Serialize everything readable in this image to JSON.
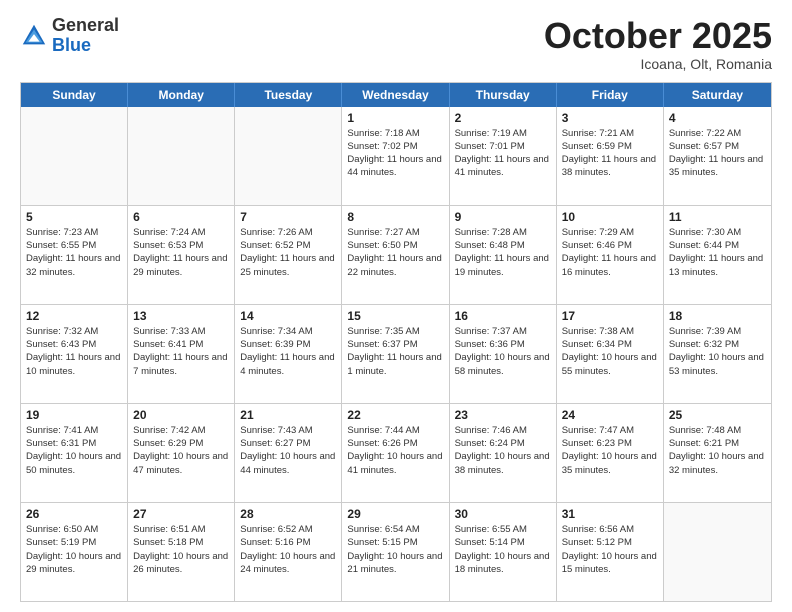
{
  "header": {
    "logo_general": "General",
    "logo_blue": "Blue",
    "month_title": "October 2025",
    "subtitle": "Icoana, Olt, Romania"
  },
  "weekdays": [
    "Sunday",
    "Monday",
    "Tuesday",
    "Wednesday",
    "Thursday",
    "Friday",
    "Saturday"
  ],
  "weeks": [
    [
      {
        "day": "",
        "info": ""
      },
      {
        "day": "",
        "info": ""
      },
      {
        "day": "",
        "info": ""
      },
      {
        "day": "1",
        "info": "Sunrise: 7:18 AM\nSunset: 7:02 PM\nDaylight: 11 hours and 44 minutes."
      },
      {
        "day": "2",
        "info": "Sunrise: 7:19 AM\nSunset: 7:01 PM\nDaylight: 11 hours and 41 minutes."
      },
      {
        "day": "3",
        "info": "Sunrise: 7:21 AM\nSunset: 6:59 PM\nDaylight: 11 hours and 38 minutes."
      },
      {
        "day": "4",
        "info": "Sunrise: 7:22 AM\nSunset: 6:57 PM\nDaylight: 11 hours and 35 minutes."
      }
    ],
    [
      {
        "day": "5",
        "info": "Sunrise: 7:23 AM\nSunset: 6:55 PM\nDaylight: 11 hours and 32 minutes."
      },
      {
        "day": "6",
        "info": "Sunrise: 7:24 AM\nSunset: 6:53 PM\nDaylight: 11 hours and 29 minutes."
      },
      {
        "day": "7",
        "info": "Sunrise: 7:26 AM\nSunset: 6:52 PM\nDaylight: 11 hours and 25 minutes."
      },
      {
        "day": "8",
        "info": "Sunrise: 7:27 AM\nSunset: 6:50 PM\nDaylight: 11 hours and 22 minutes."
      },
      {
        "day": "9",
        "info": "Sunrise: 7:28 AM\nSunset: 6:48 PM\nDaylight: 11 hours and 19 minutes."
      },
      {
        "day": "10",
        "info": "Sunrise: 7:29 AM\nSunset: 6:46 PM\nDaylight: 11 hours and 16 minutes."
      },
      {
        "day": "11",
        "info": "Sunrise: 7:30 AM\nSunset: 6:44 PM\nDaylight: 11 hours and 13 minutes."
      }
    ],
    [
      {
        "day": "12",
        "info": "Sunrise: 7:32 AM\nSunset: 6:43 PM\nDaylight: 11 hours and 10 minutes."
      },
      {
        "day": "13",
        "info": "Sunrise: 7:33 AM\nSunset: 6:41 PM\nDaylight: 11 hours and 7 minutes."
      },
      {
        "day": "14",
        "info": "Sunrise: 7:34 AM\nSunset: 6:39 PM\nDaylight: 11 hours and 4 minutes."
      },
      {
        "day": "15",
        "info": "Sunrise: 7:35 AM\nSunset: 6:37 PM\nDaylight: 11 hours and 1 minute."
      },
      {
        "day": "16",
        "info": "Sunrise: 7:37 AM\nSunset: 6:36 PM\nDaylight: 10 hours and 58 minutes."
      },
      {
        "day": "17",
        "info": "Sunrise: 7:38 AM\nSunset: 6:34 PM\nDaylight: 10 hours and 55 minutes."
      },
      {
        "day": "18",
        "info": "Sunrise: 7:39 AM\nSunset: 6:32 PM\nDaylight: 10 hours and 53 minutes."
      }
    ],
    [
      {
        "day": "19",
        "info": "Sunrise: 7:41 AM\nSunset: 6:31 PM\nDaylight: 10 hours and 50 minutes."
      },
      {
        "day": "20",
        "info": "Sunrise: 7:42 AM\nSunset: 6:29 PM\nDaylight: 10 hours and 47 minutes."
      },
      {
        "day": "21",
        "info": "Sunrise: 7:43 AM\nSunset: 6:27 PM\nDaylight: 10 hours and 44 minutes."
      },
      {
        "day": "22",
        "info": "Sunrise: 7:44 AM\nSunset: 6:26 PM\nDaylight: 10 hours and 41 minutes."
      },
      {
        "day": "23",
        "info": "Sunrise: 7:46 AM\nSunset: 6:24 PM\nDaylight: 10 hours and 38 minutes."
      },
      {
        "day": "24",
        "info": "Sunrise: 7:47 AM\nSunset: 6:23 PM\nDaylight: 10 hours and 35 minutes."
      },
      {
        "day": "25",
        "info": "Sunrise: 7:48 AM\nSunset: 6:21 PM\nDaylight: 10 hours and 32 minutes."
      }
    ],
    [
      {
        "day": "26",
        "info": "Sunrise: 6:50 AM\nSunset: 5:19 PM\nDaylight: 10 hours and 29 minutes."
      },
      {
        "day": "27",
        "info": "Sunrise: 6:51 AM\nSunset: 5:18 PM\nDaylight: 10 hours and 26 minutes."
      },
      {
        "day": "28",
        "info": "Sunrise: 6:52 AM\nSunset: 5:16 PM\nDaylight: 10 hours and 24 minutes."
      },
      {
        "day": "29",
        "info": "Sunrise: 6:54 AM\nSunset: 5:15 PM\nDaylight: 10 hours and 21 minutes."
      },
      {
        "day": "30",
        "info": "Sunrise: 6:55 AM\nSunset: 5:14 PM\nDaylight: 10 hours and 18 minutes."
      },
      {
        "day": "31",
        "info": "Sunrise: 6:56 AM\nSunset: 5:12 PM\nDaylight: 10 hours and 15 minutes."
      },
      {
        "day": "",
        "info": ""
      }
    ]
  ]
}
